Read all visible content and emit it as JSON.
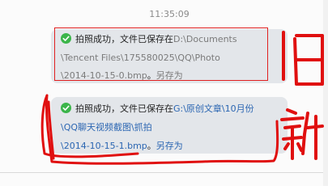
{
  "chat": {
    "timestamp": "11:35:09",
    "messages": [
      {
        "icon": "check-circle-icon",
        "prefix": "拍照成功，文件已保存在",
        "path_line1": "D:\\Documents",
        "path_line2": "\\Tencent Files\\175580025\\QQ\\Photo",
        "path_line3": "\\2014-10-15-0.bmp",
        "separator": "。",
        "save_as": "另存为"
      },
      {
        "icon": "check-circle-icon",
        "prefix": "拍照成功，文件已保存在",
        "path_line1": "G:\\原创文章\\10月份",
        "path_line2": "\\QQ聊天视频截图\\抓拍",
        "path_line3": "\\2014-10-15-1.bmp",
        "separator": "。",
        "save_as": "另存为"
      }
    ]
  },
  "annotations": {
    "old_label": "旧",
    "new_label": "新",
    "color": "#e01010"
  },
  "colors": {
    "check": "#3bb54a",
    "old_path": "#7b7b7b",
    "new_path": "#2b66b2"
  }
}
